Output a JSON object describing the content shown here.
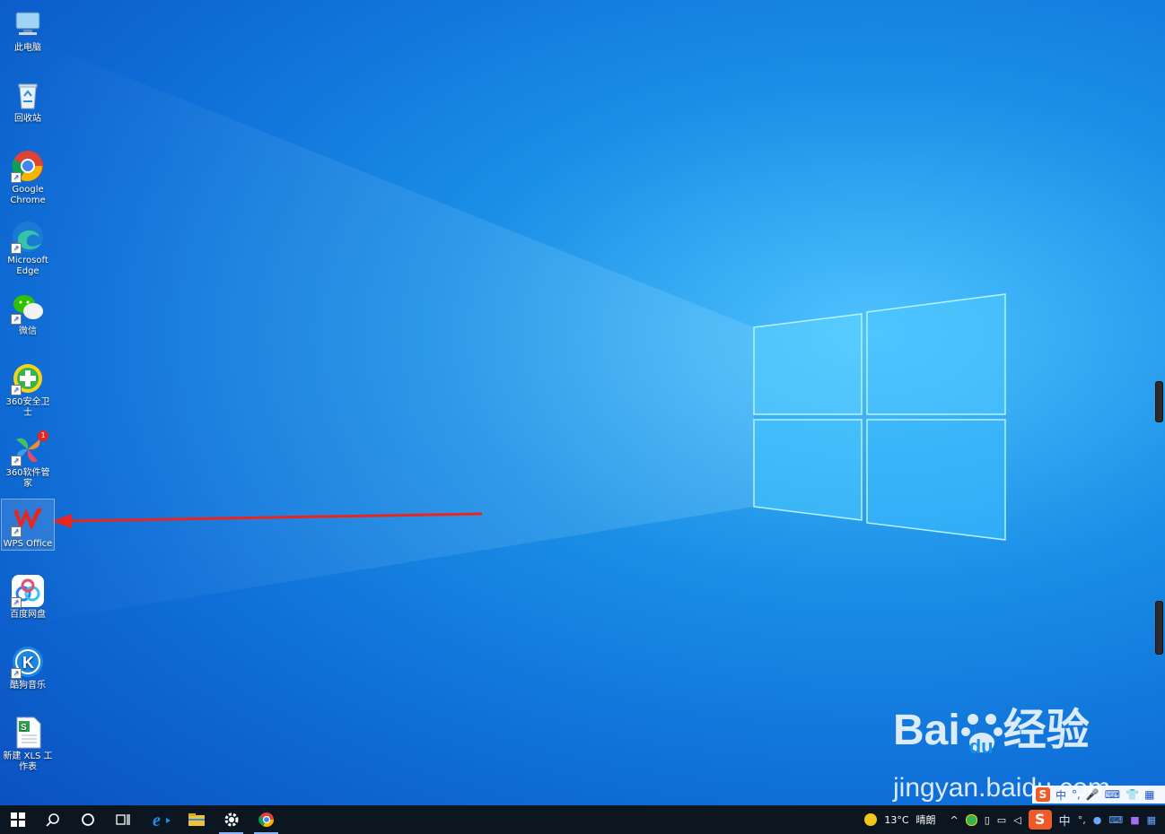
{
  "desktop": {
    "icons": [
      {
        "label": "此电脑",
        "icon": "computer-icon"
      },
      {
        "label": "回收站",
        "icon": "recycle-bin-icon"
      },
      {
        "label": "Google Chrome",
        "icon": "chrome-icon"
      },
      {
        "label": "Microsoft Edge",
        "icon": "edge-icon"
      },
      {
        "label": "微信",
        "icon": "wechat-icon"
      },
      {
        "label": "360安全卫士",
        "icon": "360-security-icon"
      },
      {
        "label": "360软件管家",
        "icon": "360-software-icon",
        "badge": "1"
      },
      {
        "label": "WPS Office",
        "icon": "wps-icon"
      },
      {
        "label": "百度网盘",
        "icon": "baidu-netdisk-icon"
      },
      {
        "label": "酷狗音乐",
        "icon": "kugou-icon"
      },
      {
        "label": "新建 XLS 工作表",
        "icon": "xls-file-icon"
      }
    ]
  },
  "watermark": {
    "brand_latin": "Bai",
    "brand_du": "du",
    "brand_cn": "经验",
    "url": "jingyan.baidu.com"
  },
  "taskbar": {
    "apps": [
      "start-icon",
      "search-icon",
      "cortana-icon",
      "task-view-icon",
      "ie-icon",
      "file-explorer-icon",
      "settings-icon",
      "chrome-icon"
    ]
  },
  "tray": {
    "weather_temp": "13°C",
    "weather_text": "晴朗",
    "ime_mode": "中",
    "ime_punct": "°,"
  },
  "colors": {
    "arrow": "#e8261f",
    "taskbar": "#0b1620",
    "accent": "#1a8fe6"
  }
}
